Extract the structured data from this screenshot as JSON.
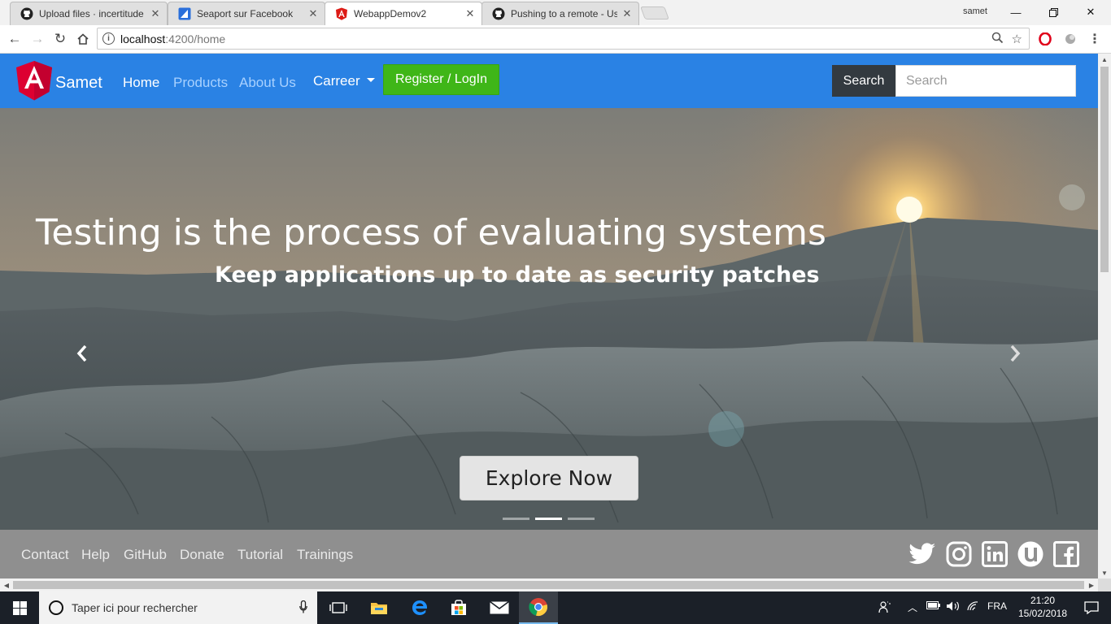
{
  "browser": {
    "tabs": [
      {
        "title": "Upload files · incertitude",
        "icon": "github-icon",
        "active": false
      },
      {
        "title": "Seaport sur Facebook",
        "icon": "seaport-icon",
        "active": false
      },
      {
        "title": "WebappDemov2",
        "icon": "angular-icon",
        "active": true
      },
      {
        "title": "Pushing to a remote - Us",
        "icon": "github-icon",
        "active": false
      }
    ],
    "profile": "samet",
    "url_host": "localhost",
    "url_path": ":4200/home"
  },
  "navbar": {
    "brand": "Samet",
    "links": [
      "Home",
      "Products",
      "About Us"
    ],
    "dropdown": "Carreer",
    "register_label": "Register / LogIn",
    "search_button": "Search",
    "search_placeholder": "Search"
  },
  "carousel": {
    "title": "Testing is the process of evaluating systems",
    "subtitle": "Keep applications up to date as security patches",
    "button": "Explore Now",
    "prev": "‹",
    "next": "›",
    "slide_count": 3,
    "active_slide": 2
  },
  "footer": {
    "links": [
      "Contact",
      "Help",
      "GitHub",
      "Donate",
      "Tutorial",
      "Trainings"
    ],
    "social": [
      "twitter-icon",
      "instagram-icon",
      "linkedin-icon",
      "utorrent-icon",
      "facebook-icon"
    ]
  },
  "taskbar": {
    "search_placeholder": "Taper ici pour rechercher",
    "language": "FRA",
    "time": "21:20",
    "date": "15/02/2018"
  },
  "colors": {
    "navbar": "#2a82e4",
    "register": "#3fb618",
    "footer": "#8f8f8f"
  }
}
